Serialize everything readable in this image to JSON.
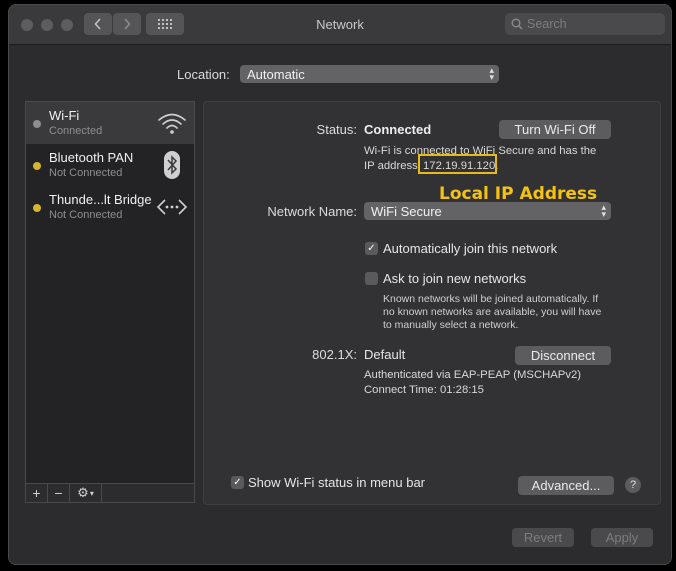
{
  "window": {
    "title": "Network"
  },
  "search": {
    "placeholder": "Search"
  },
  "location": {
    "label": "Location:",
    "value": "Automatic"
  },
  "services": [
    {
      "name": "Wi-Fi",
      "status": "Connected",
      "dot_color": "#8e8e90",
      "icon": "wifi-icon"
    },
    {
      "name": "Bluetooth PAN",
      "status": "Not Connected",
      "dot_color": "#d6b62a",
      "icon": "bluetooth-icon"
    },
    {
      "name": "Thunde...lt Bridge",
      "status": "Not Connected",
      "dot_color": "#d6b62a",
      "icon": "thunderbolt-bridge-icon"
    }
  ],
  "sidebar_tools": {
    "add": "+",
    "remove": "−",
    "gear": "⚙"
  },
  "detail": {
    "status_label": "Status:",
    "status_value": "Connected",
    "turn_off_button": "Turn Wi-Fi Off",
    "status_desc_line1": "Wi-Fi is connected to WiFi Secure and has the",
    "status_desc_prefix": "IP address",
    "ip_address": "172.19.91.120.",
    "network_name_label": "Network Name:",
    "network_name_value": "WiFi Secure",
    "auto_join_label": "Automatically join this network",
    "auto_join_checked": true,
    "ask_join_label": "Ask to join new networks",
    "ask_join_checked": false,
    "ask_join_hint_1": "Known networks will be joined automatically. If",
    "ask_join_hint_2": "no known networks are available, you will have",
    "ask_join_hint_3": "to manually select a network.",
    "dot1x_label": "802.1X:",
    "dot1x_value": "Default",
    "disconnect_button": "Disconnect",
    "auth_line": "Authenticated via EAP-PEAP (MSCHAPv2)",
    "connect_time": "Connect Time: 01:28:15",
    "show_status_label": "Show Wi-Fi status in menu bar",
    "show_status_checked": true,
    "advanced_button": "Advanced...",
    "help_button": "?"
  },
  "annotation": {
    "text": "Local IP Address",
    "color": "#f5c211"
  },
  "footer": {
    "revert_button": "Revert",
    "apply_button": "Apply"
  }
}
